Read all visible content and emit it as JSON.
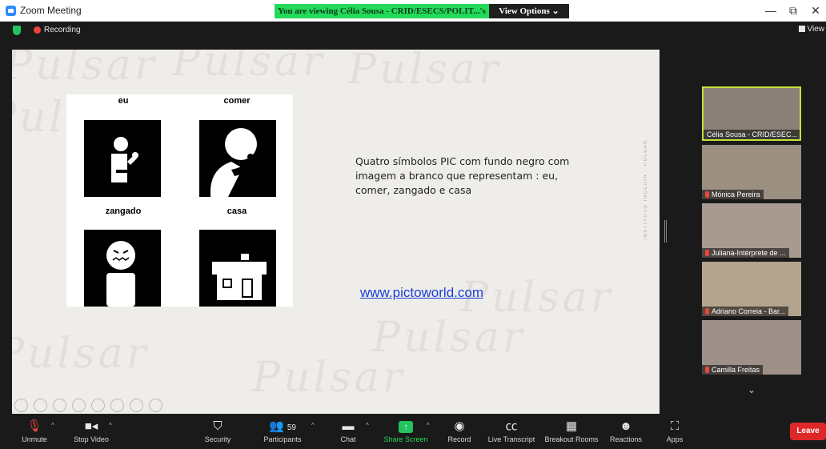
{
  "window": {
    "title": "Zoom Meeting",
    "viewing_banner": "You are viewing Célia Sousa - CRID/ESECS/POLIT...'s screen",
    "view_options": "View Options ⌄",
    "minimize": "—",
    "restore": "⧉",
    "close": "✕"
  },
  "infobar": {
    "recording_label": "Recording",
    "view_label": "View"
  },
  "slide": {
    "watermark": "Pulsar",
    "pics": [
      {
        "label": "eu",
        "icon": "person-pointing-self-icon"
      },
      {
        "label": "comer",
        "icon": "person-eating-icon"
      },
      {
        "label": "zangado",
        "icon": "angry-face-icon"
      },
      {
        "label": "casa",
        "icon": "house-icon"
      }
    ],
    "caption": "Quatro símbolos PIC com fundo  negro com imagem a branco que representam : eu, comer, zangado e casa",
    "link": "www.pictoworld.com",
    "vertical_text": "INSTITUTO INCLUIR · PULSAR"
  },
  "gallery": {
    "participants": [
      {
        "name": "Célia Sousa - CRID/ESEC...",
        "muted": false,
        "active": true,
        "bg": "#8a8078"
      },
      {
        "name": "Mónica Pereira",
        "muted": true,
        "active": false,
        "bg": "#9a8f80"
      },
      {
        "name": "Juliana-Intérprete de ...",
        "muted": true,
        "active": false,
        "bg": "#a89a90"
      },
      {
        "name": "Adriano Correia - Bar...",
        "muted": true,
        "active": false,
        "bg": "#b3a48e"
      },
      {
        "name": "Camilla Freitas",
        "muted": true,
        "active": false,
        "bg": "#9c9088"
      }
    ],
    "down_icon": "⌄"
  },
  "toolbar": {
    "unmute": "Unmute",
    "stop_video": "Stop Video",
    "security": "Security",
    "participants": "Participants",
    "participants_count": "59",
    "chat": "Chat",
    "share_screen": "Share Screen",
    "record": "Record",
    "live_transcript": "Live Transcript",
    "breakout_rooms": "Breakout Rooms",
    "reactions": "Reactions",
    "apps": "Apps",
    "leave": "Leave"
  },
  "colors": {
    "accent_green": "#23d959",
    "leave_red": "#e02828",
    "active_speaker": "#c6e03b"
  }
}
